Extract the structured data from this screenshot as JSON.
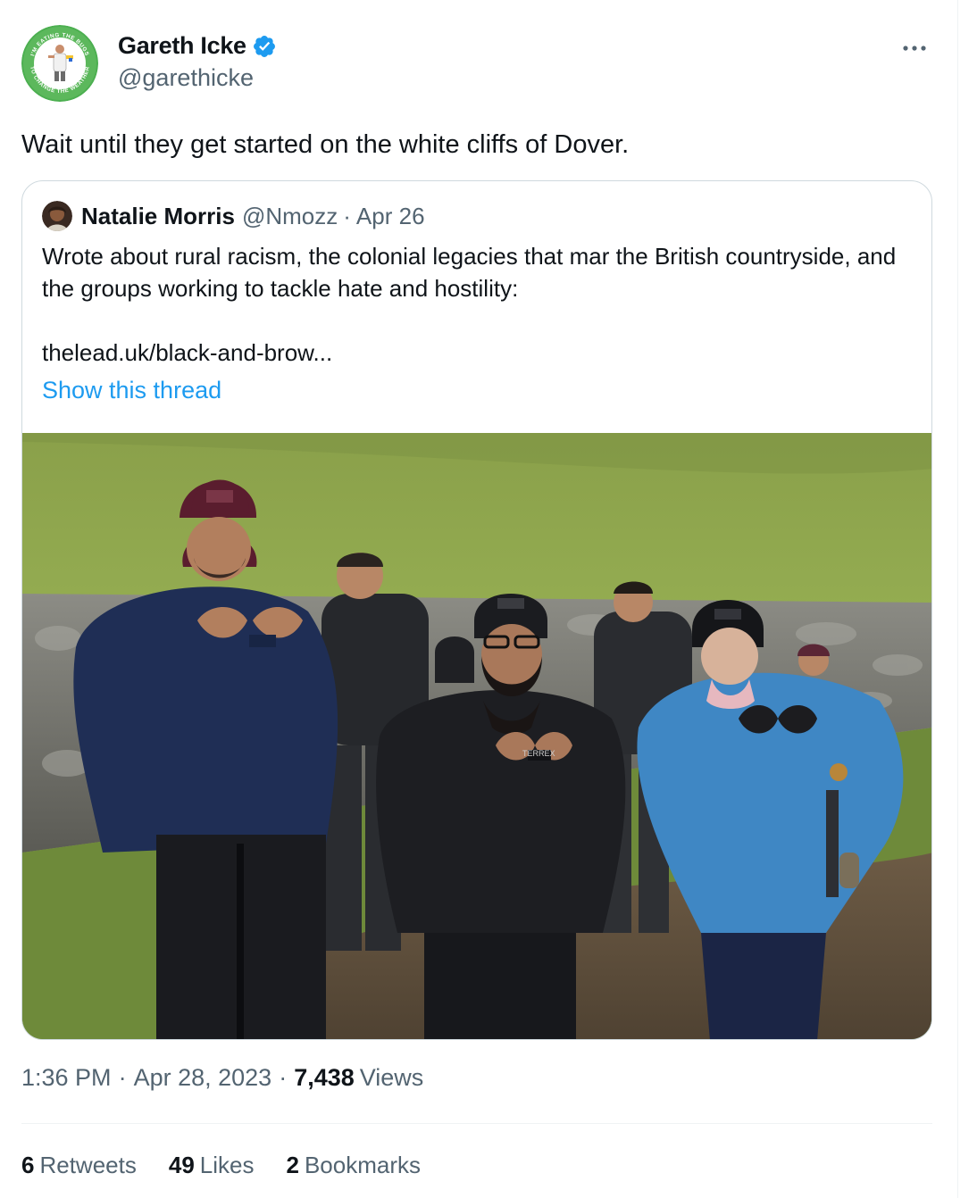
{
  "author": {
    "display_name": "Gareth Icke",
    "handle": "@garethicke",
    "verified": true,
    "avatar_ring_text_top": "I'M EATING THE BUGS",
    "avatar_ring_text_bottom": "TO CHANGE THE WEATHER"
  },
  "tweet": {
    "text": "Wait until they get started on the white cliffs of Dover."
  },
  "quote": {
    "display_name": "Natalie Morris",
    "handle": "@Nmozz",
    "separator": "·",
    "date": "Apr 26",
    "body": "Wrote about rural racism, the colonial legacies that mar the British countryside, and the groups working to tackle hate and hostility:",
    "link": "thelead.uk/black-and-brow...",
    "show_thread": "Show this thread",
    "photo_caption_text": "TERREX"
  },
  "meta": {
    "time": "1:36 PM",
    "separator": "·",
    "date": "Apr 28, 2023",
    "views_count": "7,438",
    "views_label": "Views"
  },
  "stats": [
    {
      "count": "6",
      "label": "Retweets"
    },
    {
      "count": "49",
      "label": "Likes"
    },
    {
      "count": "2",
      "label": "Bookmarks"
    }
  ],
  "colors": {
    "text": "#0f1419",
    "secondary": "#536471",
    "accent": "#1d9bf0",
    "border": "#cfd9de",
    "divider": "#eff3f4"
  },
  "icons": {
    "verified": "verified-badge-icon",
    "more": "more-options-icon"
  }
}
